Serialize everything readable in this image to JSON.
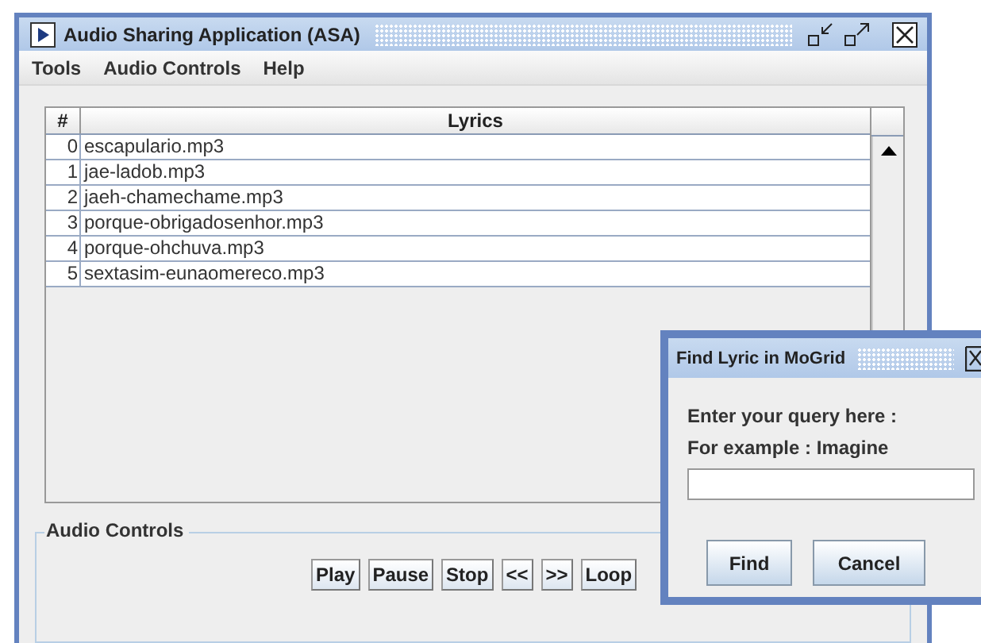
{
  "window": {
    "title": "Audio Sharing Application (ASA)"
  },
  "menu": [
    "Tools",
    "Audio Controls",
    "Help"
  ],
  "table": {
    "columns": [
      "#",
      "Lyrics"
    ],
    "rows": [
      {
        "index": "0",
        "name": "escapulario.mp3"
      },
      {
        "index": "1",
        "name": "jae-ladob.mp3"
      },
      {
        "index": "2",
        "name": "jaeh-chamechame.mp3"
      },
      {
        "index": "3",
        "name": "porque-obrigadosenhor.mp3"
      },
      {
        "index": "4",
        "name": "porque-ohchuva.mp3"
      },
      {
        "index": "5",
        "name": "sextasim-eunaomereco.mp3"
      }
    ]
  },
  "audio_controls": {
    "title": "Audio Controls",
    "buttons": [
      "Play",
      "Pause",
      "Stop",
      "<<",
      ">>",
      "Loop"
    ]
  },
  "dialog": {
    "title": "Find Lyric in MoGrid",
    "lines": [
      "Enter your query here :",
      "For example : Imagine"
    ],
    "buttons": [
      "Find",
      "Cancel"
    ]
  }
}
